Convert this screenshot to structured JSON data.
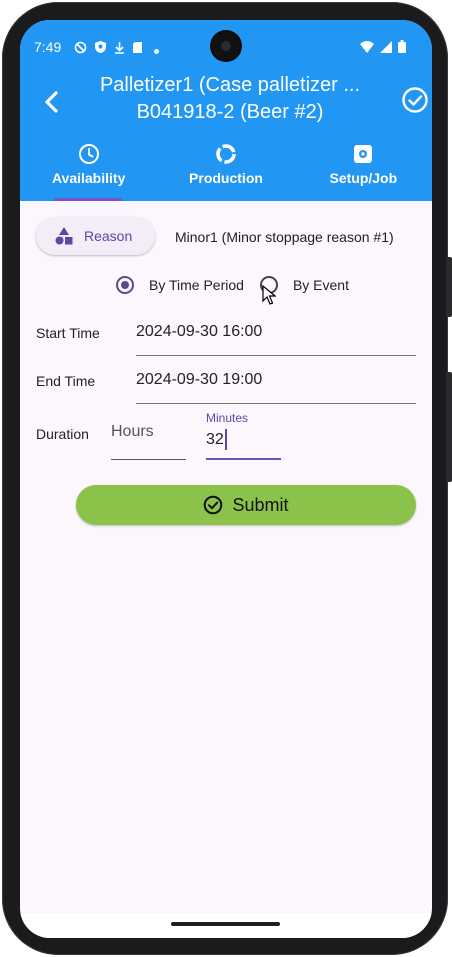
{
  "status_bar": {
    "time": "7:49",
    "icons": [
      "shield-off-icon",
      "vpn-shield-icon",
      "download-icon",
      "sd-card-icon",
      "dot-icon"
    ],
    "right_icons": [
      "wifi-icon",
      "signal-icon",
      "battery-icon"
    ]
  },
  "header": {
    "title_line1": "Palletizer1 (Case palletizer ...",
    "title_line2": "B041918-2 (Beer #2)",
    "back_icon": "chevron-left-icon",
    "confirm_icon": "check-circle-icon",
    "background": "#2196f3"
  },
  "tabs": [
    {
      "label": "Availability",
      "icon": "clock-icon",
      "selected": true
    },
    {
      "label": "Production",
      "icon": "donut-icon",
      "selected": false
    },
    {
      "label": "Setup/Job",
      "icon": "setup-icon",
      "selected": false
    }
  ],
  "reason": {
    "button_label": "Reason",
    "icon": "shapes-icon",
    "value": "Minor1 (Minor stoppage reason #1)"
  },
  "mode": {
    "options": [
      "By Time Period",
      "By Event"
    ],
    "selected": "By Time Period"
  },
  "form": {
    "start_label": "Start Time",
    "start_value": "2024-09-30 16:00",
    "end_label": "End Time",
    "end_value": "2024-09-30 19:00",
    "duration_label": "Duration",
    "hours_placeholder": "Hours",
    "minutes_caption": "Minutes",
    "minutes_value": "32"
  },
  "submit": {
    "label": "Submit",
    "icon": "check-circle-icon",
    "color": "#8bc34a"
  },
  "colors": {
    "accent": "#5a49a8",
    "background": "#fcf6fd"
  }
}
